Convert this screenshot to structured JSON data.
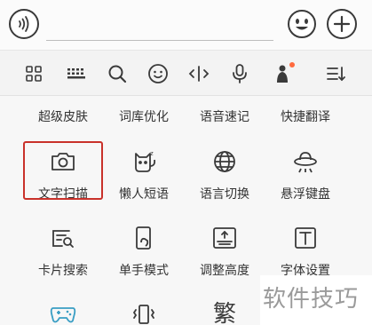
{
  "input_bar": {
    "voice_icon": "voice-wave-icon",
    "emoji_icon": "smiley-icon",
    "add_icon": "plus-icon"
  },
  "toolbar": {
    "icons": [
      "grid-menu-icon",
      "keyboard-icon",
      "search-icon",
      "emoji-icon",
      "cursor-move-icon",
      "microphone-icon",
      "avatar-icon",
      "collapse-icon"
    ],
    "badge_color": "#ff6a3d"
  },
  "features": {
    "row0": [
      "超级皮肤",
      "词库优化",
      "语音速记",
      "快捷翻译"
    ],
    "row1": [
      "文字扫描",
      "懒人短语",
      "语言切换",
      "悬浮键盘"
    ],
    "row2": [
      "卡片搜索",
      "单手模式",
      "调整高度",
      "字体设置"
    ],
    "row3_partial": [
      "",
      "",
      "繁",
      ""
    ]
  },
  "highlight_color": "#c9312a",
  "watermark": "软件技巧"
}
